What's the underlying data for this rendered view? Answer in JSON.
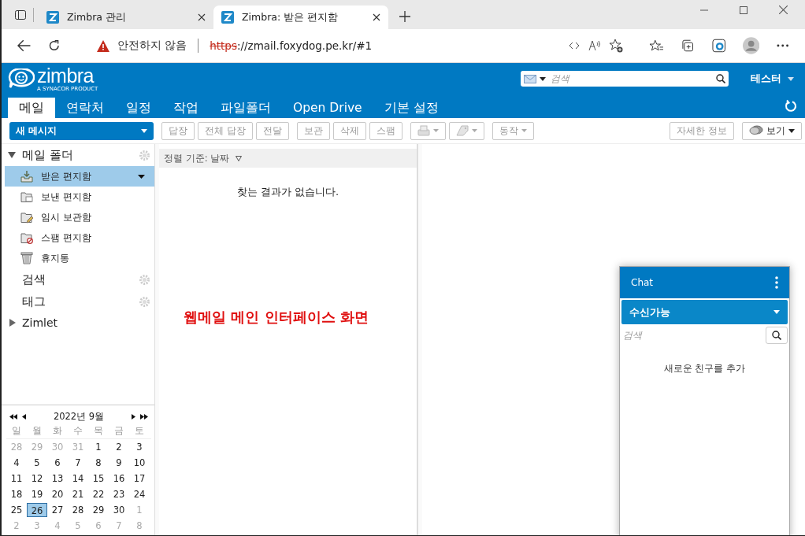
{
  "browser": {
    "tabs": [
      {
        "title": "Zimbra 관리",
        "selected": false
      },
      {
        "title": "Zimbra: 받은 편지함",
        "selected": true
      }
    ],
    "security_label": "안전하지 않음",
    "url_scheme": "https",
    "url_rest": "://zmail.foxydog.pe.kr/#1"
  },
  "header": {
    "logo_text": "zimbra",
    "logo_tagline": "A SYNACOR PRODUCT",
    "search_placeholder": "검색",
    "user": "테스터"
  },
  "nav_tabs": [
    {
      "label": "메일",
      "selected": true
    },
    {
      "label": "연락처",
      "selected": false
    },
    {
      "label": "일정",
      "selected": false
    },
    {
      "label": "작업",
      "selected": false
    },
    {
      "label": "파일폴더",
      "selected": false
    },
    {
      "label": "Open Drive",
      "selected": false
    },
    {
      "label": "기본 설정",
      "selected": false
    }
  ],
  "toolbar": {
    "new_message": "새 메시지",
    "button_groups": [
      [
        {
          "label": "답장",
          "disabled": true
        },
        {
          "label": "전체 답장",
          "disabled": true
        },
        {
          "label": "전달",
          "disabled": true
        }
      ],
      [
        {
          "label": "보관",
          "disabled": true
        },
        {
          "label": "삭제",
          "disabled": true
        },
        {
          "label": "스팸",
          "disabled": true
        }
      ]
    ],
    "action_button": {
      "label": "동작",
      "disabled": true
    },
    "detail_button": {
      "label": "자세한 정보",
      "disabled": true
    },
    "view_button": {
      "label": "보기",
      "disabled": false
    }
  },
  "sidebar": {
    "folder_header": {
      "label": "메일 폴더",
      "expanded": true
    },
    "folders": [
      {
        "label": "받은 편지함",
        "kind": "inbox",
        "selected": true
      },
      {
        "label": "보낸 편지함",
        "kind": "sent",
        "selected": false
      },
      {
        "label": "임시 보관함",
        "kind": "drafts",
        "selected": false
      },
      {
        "label": "스팸 편지함",
        "kind": "spam",
        "selected": false
      },
      {
        "label": "휴지통",
        "kind": "trash",
        "selected": false
      }
    ],
    "sections": [
      {
        "label": "검색"
      },
      {
        "label": "태그"
      }
    ],
    "zimlet": {
      "label": "Zimlet",
      "expanded": false
    }
  },
  "calendar": {
    "title": "2022년 9월",
    "weekdays": [
      "일",
      "월",
      "화",
      "수",
      "목",
      "금",
      "토"
    ],
    "weeks": [
      [
        {
          "day": "28",
          "other_month": true,
          "selected": false
        },
        {
          "day": "29",
          "other_month": true,
          "selected": false
        },
        {
          "day": "30",
          "other_month": true,
          "selected": false
        },
        {
          "day": "31",
          "other_month": true,
          "selected": false
        },
        {
          "day": "1",
          "other_month": false,
          "selected": false
        },
        {
          "day": "2",
          "other_month": false,
          "selected": false
        },
        {
          "day": "3",
          "other_month": false,
          "selected": false
        }
      ],
      [
        {
          "day": "4",
          "other_month": false,
          "selected": false
        },
        {
          "day": "5",
          "other_month": false,
          "selected": false
        },
        {
          "day": "6",
          "other_month": false,
          "selected": false
        },
        {
          "day": "7",
          "other_month": false,
          "selected": false
        },
        {
          "day": "8",
          "other_month": false,
          "selected": false
        },
        {
          "day": "9",
          "other_month": false,
          "selected": false
        },
        {
          "day": "10",
          "other_month": false,
          "selected": false
        }
      ],
      [
        {
          "day": "11",
          "other_month": false,
          "selected": false
        },
        {
          "day": "12",
          "other_month": false,
          "selected": false
        },
        {
          "day": "13",
          "other_month": false,
          "selected": false
        },
        {
          "day": "14",
          "other_month": false,
          "selected": false
        },
        {
          "day": "15",
          "other_month": false,
          "selected": false
        },
        {
          "day": "16",
          "other_month": false,
          "selected": false
        },
        {
          "day": "17",
          "other_month": false,
          "selected": false
        }
      ],
      [
        {
          "day": "18",
          "other_month": false,
          "selected": false
        },
        {
          "day": "19",
          "other_month": false,
          "selected": false
        },
        {
          "day": "20",
          "other_month": false,
          "selected": false
        },
        {
          "day": "21",
          "other_month": false,
          "selected": false
        },
        {
          "day": "22",
          "other_month": false,
          "selected": false
        },
        {
          "day": "23",
          "other_month": false,
          "selected": false
        },
        {
          "day": "24",
          "other_month": false,
          "selected": false
        }
      ],
      [
        {
          "day": "25",
          "other_month": false,
          "selected": false
        },
        {
          "day": "26",
          "other_month": false,
          "selected": true
        },
        {
          "day": "27",
          "other_month": false,
          "selected": false
        },
        {
          "day": "28",
          "other_month": false,
          "selected": false
        },
        {
          "day": "29",
          "other_month": false,
          "selected": false
        },
        {
          "day": "30",
          "other_month": false,
          "selected": false
        },
        {
          "day": "1",
          "other_month": true,
          "selected": false
        }
      ],
      [
        {
          "day": "2",
          "other_month": true,
          "selected": false
        },
        {
          "day": "3",
          "other_month": true,
          "selected": false
        },
        {
          "day": "4",
          "other_month": true,
          "selected": false
        },
        {
          "day": "5",
          "other_month": true,
          "selected": false
        },
        {
          "day": "6",
          "other_month": true,
          "selected": false
        },
        {
          "day": "7",
          "other_month": true,
          "selected": false
        },
        {
          "day": "8",
          "other_month": true,
          "selected": false
        }
      ]
    ]
  },
  "message_list": {
    "sort_label": "정렬 기준: 날짜",
    "empty_text": "찾는 결과가 없습니다."
  },
  "annotation": "웹메일 메인 인터페이스 화면",
  "chat": {
    "title": "Chat",
    "status": "수신가능",
    "search_placeholder": "검색",
    "add_friend": "새로운 친구를 추가"
  }
}
